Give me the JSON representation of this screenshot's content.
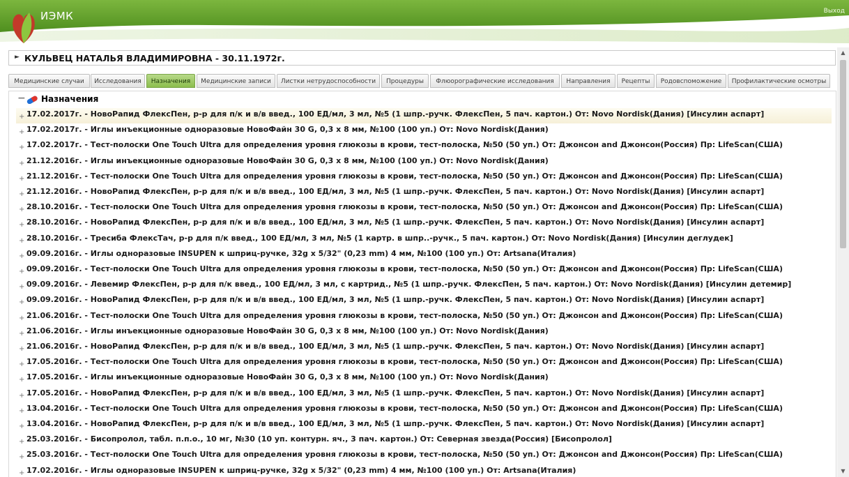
{
  "header": {
    "app_title": "ИЭМК",
    "logout_label": "Выход",
    "colors": {
      "accent": "#6aa62e",
      "accent_light": "#a8d070",
      "tab_active": "#9cc95e"
    }
  },
  "patient": {
    "name_line": "КУЛЬВЕЦ НАТАЛЬЯ ВЛАДИМИРОВНА - 30.11.1972г."
  },
  "tabs": [
    {
      "label": "Медицинские случаи"
    },
    {
      "label": "Исследования"
    },
    {
      "label": "Назначения"
    },
    {
      "label": "Медицинские записи"
    },
    {
      "label": "Листки нетрудоспособности"
    },
    {
      "label": "Процедуры"
    },
    {
      "label": "Флюорографические исследования"
    },
    {
      "label": "Направления"
    },
    {
      "label": "Рецепты"
    },
    {
      "label": "Родовспоможение"
    },
    {
      "label": "Профилактические осмотры"
    }
  ],
  "active_tab": "Назначения",
  "tree": {
    "root_label": "Назначения",
    "root_icon": "pill-icon",
    "items": [
      "17.02.2017г. - НовоРапид ФлексПен, р-р для п/к и в/в введ., 100 ЕД/мл, 3 мл, №5 (1 шпр.-ручк. ФлексПен, 5 пач. картон.) От: Novo Nordisk(Дания) [Инсулин аспарт]",
      "17.02.2017г. - Иглы инъекционные одноразовые НовоФайн 30 G, 0,3 х 8 мм, №100 (100 уп.) От: Novo Nordisk(Дания)",
      "17.02.2017г. - Тест-полоски One Touch Ultra для определения уровня глюкозы в крови, тест-полоска, №50 (50 уп.) От: Джонсон and Джонсон(Россия) Пр: LifeScan(США)",
      "21.12.2016г. - Иглы инъекционные одноразовые НовоФайн 30 G, 0,3 х 8 мм, №100 (100 уп.) От: Novo Nordisk(Дания)",
      "21.12.2016г. - Тест-полоски One Touch Ultra для определения уровня глюкозы в крови, тест-полоска, №50 (50 уп.) От: Джонсон and Джонсон(Россия) Пр: LifeScan(США)",
      "21.12.2016г. - НовоРапид ФлексПен, р-р для п/к и в/в введ., 100 ЕД/мл, 3 мл, №5 (1 шпр.-ручк. ФлексПен, 5 пач. картон.) От: Novo Nordisk(Дания) [Инсулин аспарт]",
      "28.10.2016г. - Тест-полоски One Touch Ultra для определения уровня глюкозы в крови, тест-полоска, №50 (50 уп.) От: Джонсон and Джонсон(Россия) Пр: LifeScan(США)",
      "28.10.2016г. - НовоРапид ФлексПен, р-р для п/к и в/в введ., 100 ЕД/мл, 3 мл, №5 (1 шпр.-ручк. ФлексПен, 5 пач. картон.) От: Novo Nordisk(Дания) [Инсулин аспарт]",
      "28.10.2016г. - Тресиба ФлексТач, р-р для п/к введ., 100 ЕД/мл, 3 мл, №5 (1 картр. в шпр..-ручк., 5 пач. картон.) От: Novo Nordisk(Дания) [Инсулин деглудек]",
      "09.09.2016г. - Иглы одноразовые INSUPEN к шприц-ручке, 32g x 5/32\" (0,23 mm) 4 мм, №100 (100 уп.) От: Artsana(Италия)",
      "09.09.2016г. - Тест-полоски One Touch Ultra для определения уровня глюкозы в крови, тест-полоска, №50 (50 уп.) От: Джонсон and Джонсон(Россия) Пр: LifeScan(США)",
      "09.09.2016г. - Левемир ФлексПен, р-р для п/к введ., 100 ЕД/мл, 3 мл, с картрид., №5 (1 шпр.-ручк. ФлексПен, 5 пач. картон.) От: Novo Nordisk(Дания) [Инсулин детемир]",
      "09.09.2016г. - НовоРапид ФлексПен, р-р для п/к и в/в введ., 100 ЕД/мл, 3 мл, №5 (1 шпр.-ручк. ФлексПен, 5 пач. картон.) От: Novo Nordisk(Дания) [Инсулин аспарт]",
      "21.06.2016г. - Тест-полоски One Touch Ultra для определения уровня глюкозы в крови, тест-полоска, №50 (50 уп.) От: Джонсон and Джонсон(Россия) Пр: LifeScan(США)",
      "21.06.2016г. - Иглы инъекционные одноразовые НовоФайн 30 G, 0,3 х 8 мм, №100 (100 уп.) От: Novo Nordisk(Дания)",
      "21.06.2016г. - НовоРапид ФлексПен, р-р для п/к и в/в введ., 100 ЕД/мл, 3 мл, №5 (1 шпр.-ручк. ФлексПен, 5 пач. картон.) От: Novo Nordisk(Дания) [Инсулин аспарт]",
      "17.05.2016г. - Тест-полоски One Touch Ultra для определения уровня глюкозы в крови, тест-полоска, №50 (50 уп.) От: Джонсон and Джонсон(Россия) Пр: LifeScan(США)",
      "17.05.2016г. - Иглы инъекционные одноразовые НовоФайн 30 G, 0,3 х 8 мм, №100 (100 уп.) От: Novo Nordisk(Дания)",
      "17.05.2016г. - НовоРапид ФлексПен, р-р для п/к и в/в введ., 100 ЕД/мл, 3 мл, №5 (1 шпр.-ручк. ФлексПен, 5 пач. картон.) От: Novo Nordisk(Дания) [Инсулин аспарт]",
      "13.04.2016г. - Тест-полоски One Touch Ultra для определения уровня глюкозы в крови, тест-полоска, №50 (50 уп.) От: Джонсон and Джонсон(Россия) Пр: LifeScan(США)",
      "13.04.2016г. - НовоРапид ФлексПен, р-р для п/к и в/в введ., 100 ЕД/мл, 3 мл, №5 (1 шпр.-ручк. ФлексПен, 5 пач. картон.) От: Novo Nordisk(Дания) [Инсулин аспарт]",
      "25.03.2016г. - Бисопролол, табл. п.п.о., 10 мг, №30 (10 уп. контурн. яч., 3 пач. картон.) От: Северная звезда(Россия) [Бисопролол]",
      "25.03.2016г. - Тест-полоски One Touch Ultra для определения уровня глюкозы в крови, тест-полоска, №50 (50 уп.) От: Джонсон and Джонсон(Россия) Пр: LifeScan(США)",
      "17.02.2016г. - Иглы одноразовые INSUPEN к шприц-ручке, 32g x 5/32\" (0,23 mm) 4 мм, №100 (100 уп.) От: Artsana(Италия)"
    ]
  }
}
